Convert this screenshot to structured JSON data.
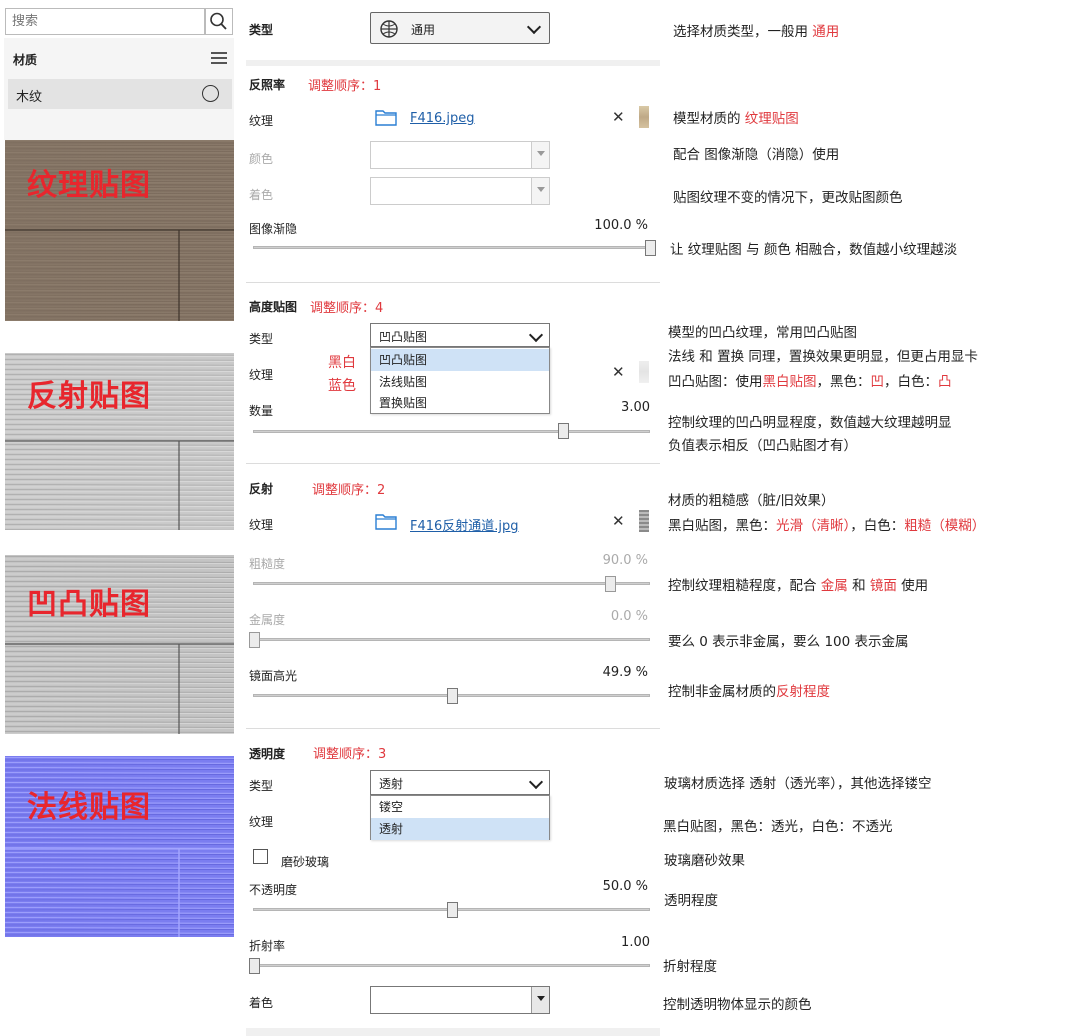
{
  "search": {
    "placeholder": "搜索"
  },
  "sidebar": {
    "title": "材质",
    "item_label": "木纹",
    "textures": [
      "纹理贴图",
      "反射贴图",
      "凹凸贴图",
      "法线贴图"
    ]
  },
  "type_row": {
    "label": "类型",
    "value": "通用"
  },
  "albedo": {
    "title": "反照率",
    "order": "调整顺序：1",
    "texture_label": "纹理",
    "texture_file": "F416.jpeg",
    "color_label": "颜色",
    "tint_label": "着色",
    "fade_label": "图像渐隐",
    "fade_value": "100.0 %",
    "fade_fraction": 1.0
  },
  "height": {
    "title": "高度贴图",
    "order": "调整顺序：4",
    "type_label": "类型",
    "type_value": "凹凸贴图",
    "options": [
      "凹凸贴图",
      "法线贴图",
      "置换贴图"
    ],
    "texture_label": "纹理",
    "hint_line1": "黑白",
    "hint_line2": "蓝色",
    "amount_label": "数量",
    "amount_value": "3.00",
    "amount_fraction": 0.78
  },
  "reflection": {
    "title": "反射",
    "order": "调整顺序：2",
    "texture_label": "纹理",
    "texture_file": "F416反射通道.jpg",
    "roughness_label": "粗糙度",
    "roughness_value": "90.0 %",
    "roughness_fraction": 0.9,
    "metal_label": "金属度",
    "metal_value": "0.0 %",
    "metal_fraction": 0.0,
    "specular_label": "镜面高光",
    "specular_value": "49.9 %",
    "specular_fraction": 0.499
  },
  "transparency": {
    "title": "透明度",
    "order": "调整顺序：3",
    "type_label": "类型",
    "type_value": "透射",
    "options": [
      "镂空",
      "透射"
    ],
    "texture_label": "纹理",
    "frosted_label": "磨砂玻璃",
    "opacity_label": "不透明度",
    "opacity_value": "50.0 %",
    "opacity_fraction": 0.5,
    "ior_label": "折射率",
    "ior_value": "1.00",
    "ior_fraction": 0.0,
    "tint_label": "着色"
  },
  "notes": {
    "n1_a": "选择材质类型，一般用 ",
    "n1_b": "通用",
    "n2_a": "模型材质的 ",
    "n2_b": "纹理贴图",
    "n3": "配合 图像渐隐（消隐）使用",
    "n4": "贴图纹理不变的情况下，更改贴图颜色",
    "n5": "让 纹理贴图 与 颜色 相融合，数值越小纹理越淡",
    "n6": "模型的凹凸纹理，常用凹凸贴图",
    "n7": "法线 和 置换 同理，置换效果更明显，但更占用显卡",
    "n8_a": "凹凸贴图：使用",
    "n8_b": "黑白贴图",
    "n8_c": "，黑色：",
    "n8_d": "凹",
    "n8_e": "，白色：",
    "n8_f": "凸",
    "n9": "控制纹理的凹凸明显程度，数值越大纹理越明显",
    "n10": "负值表示相反（凹凸贴图才有）",
    "n11": "材质的粗糙感（脏/旧效果）",
    "n12_a": "黑白贴图，黑色：",
    "n12_b": "光滑（清晰）",
    "n12_c": "，白色：",
    "n12_d": "粗糙（模糊）",
    "n13_a": "控制纹理粗糙程度，配合 ",
    "n13_b": "金属",
    "n13_c": " 和 ",
    "n13_d": "镜面",
    "n13_e": " 使用",
    "n14": "要么 0 表示非金属，要么 100 表示金属",
    "n15_a": "控制非金属材质的",
    "n15_b": "反射程度",
    "n16": "玻璃材质选择 透射（透光率），其他选择镂空",
    "n17": "黑白贴图，黑色：透光，白色：不透光",
    "n18": "玻璃磨砂效果",
    "n19": "透明程度",
    "n20": "折射程度",
    "n21": "控制透明物体显示的颜色"
  },
  "colors": {
    "accent_red": "#e0393e",
    "link_blue": "#1f5fa8",
    "normal_map": "#7b7df0"
  }
}
